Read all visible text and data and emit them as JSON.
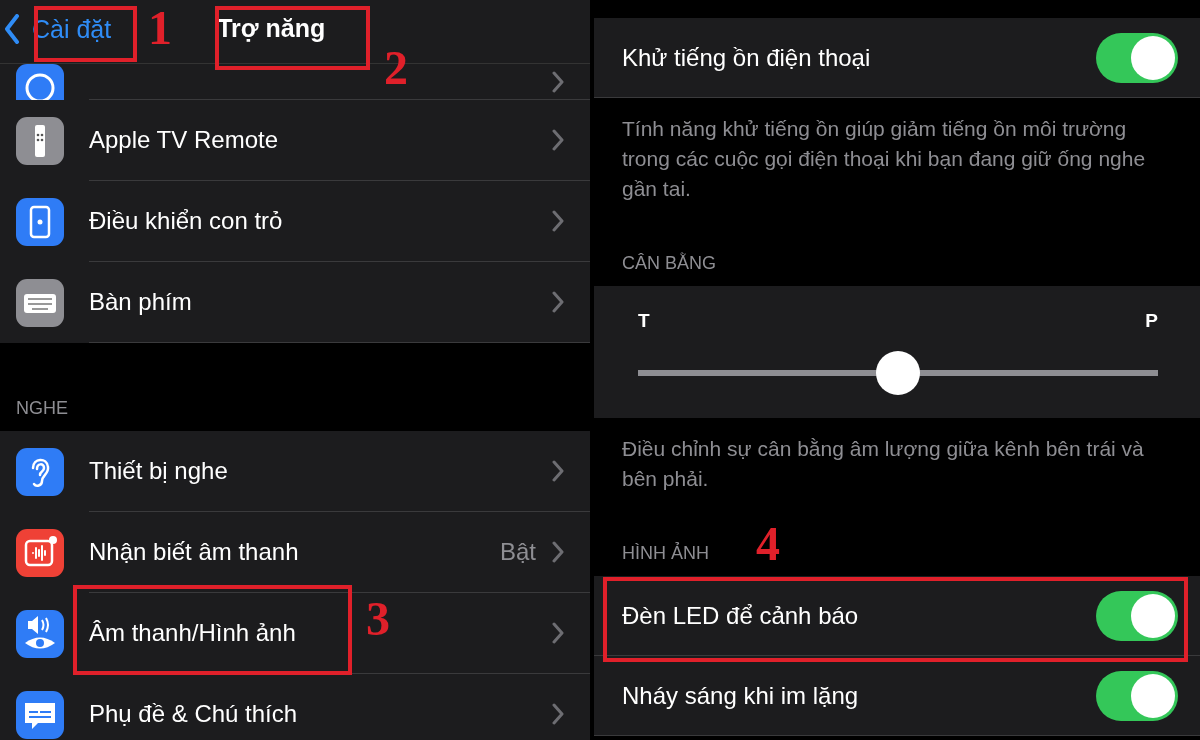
{
  "left_screen": {
    "nav": {
      "back": "Cài đặt",
      "title": "Trợ năng"
    },
    "groups": [
      {
        "items": [
          {
            "kind": "partial",
            "color": "#2f7cf6"
          },
          {
            "kind": "item",
            "label": "Apple TV Remote",
            "color": "#8e8e93"
          },
          {
            "kind": "item",
            "label": "Điều khiển con trỏ",
            "color": "#2f7cf6"
          },
          {
            "kind": "item",
            "label": "Bàn phím",
            "color": "#8e8e93"
          }
        ]
      },
      {
        "header": "NGHE",
        "items": [
          {
            "kind": "item",
            "label": "Thiết bị nghe",
            "color": "#2f7cf6"
          },
          {
            "kind": "item",
            "label": "Nhận biết âm thanh",
            "value": "Bật",
            "color": "#ef4136"
          },
          {
            "kind": "item",
            "label": "Âm thanh/Hình ảnh",
            "color": "#2f7cf6"
          },
          {
            "kind": "item",
            "label": "Phụ đề & Chú thích",
            "color": "#2f7cf6"
          }
        ]
      }
    ]
  },
  "right_screen": {
    "blocks": [
      {
        "kind": "toggle",
        "label": "Khử tiếng ồn điện thoại",
        "on": true
      },
      {
        "kind": "footer",
        "text": "Tính năng khử tiếng ồn giúp giảm tiếng ồn môi trường trong các cuộc gọi điện thoại khi bạn đang giữ ống nghe gần tai."
      },
      {
        "kind": "header",
        "text": "CÂN BẰNG"
      },
      {
        "kind": "slider",
        "left_label": "T",
        "right_label": "P",
        "level": 0.5
      },
      {
        "kind": "footer",
        "text": "Điều chỉnh sự cân bằng âm lượng giữa kênh bên trái và bên phải."
      },
      {
        "kind": "header",
        "text": "HÌNH ẢNH"
      },
      {
        "kind": "toggle",
        "label": "Đèn LED để cảnh báo",
        "on": true
      },
      {
        "kind": "toggle",
        "label": "Nháy sáng khi im lặng",
        "on": true
      }
    ]
  },
  "annotations": [
    {
      "number": "1"
    },
    {
      "number": "2"
    },
    {
      "number": "3"
    },
    {
      "number": "4"
    }
  ]
}
